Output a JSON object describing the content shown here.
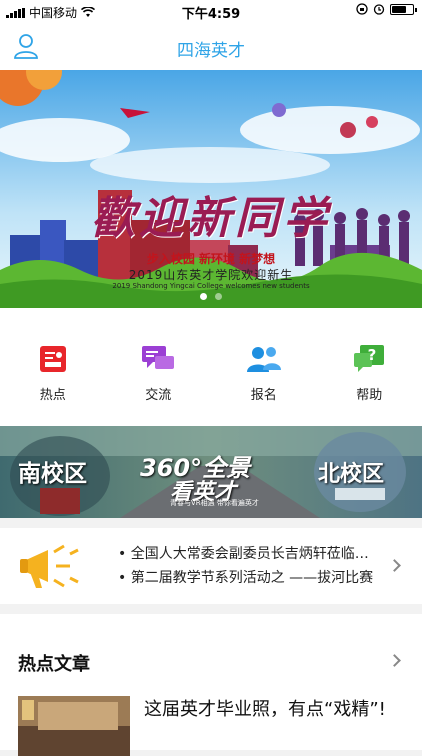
{
  "status_bar": {
    "carrier": "中国移动",
    "time": "下午4:59"
  },
  "nav": {
    "title": "四海英才",
    "user_icon": "user-icon"
  },
  "banner": {
    "headline": "歡迎新同学",
    "subtitle": "步入校园 新环境 新梦想",
    "title_cn": "2019山东英才学院欢迎新生",
    "title_en": "2019 Shandong Yingcai College welcomes new students",
    "slides": 2,
    "active_slide": 1
  },
  "menu": [
    {
      "label": "热点",
      "icon": "hot-icon",
      "color": "#e8262b"
    },
    {
      "label": "交流",
      "icon": "chat-icon",
      "color": "#9b3fd4"
    },
    {
      "label": "报名",
      "icon": "people-icon",
      "color": "#1e8fe0"
    },
    {
      "label": "帮助",
      "icon": "help-icon",
      "color": "#3fae3a"
    }
  ],
  "panorama": {
    "left": "南校区",
    "center_line1": "360°全景",
    "center_line2": "看英才",
    "center_small": "青春与VR相遇 带你看遍英才",
    "right": "北校区"
  },
  "notices": [
    "全国人大常委会副委员长吉炳轩莅临山东英才学院视察",
    "第二届教学节系列活动之 ——拔河比赛"
  ],
  "hot_section": {
    "title": "热点文章",
    "articles": [
      {
        "title": "这届英才毕业照，有点“戏精”!"
      }
    ]
  },
  "colors": {
    "accent": "#2fa4e7"
  }
}
